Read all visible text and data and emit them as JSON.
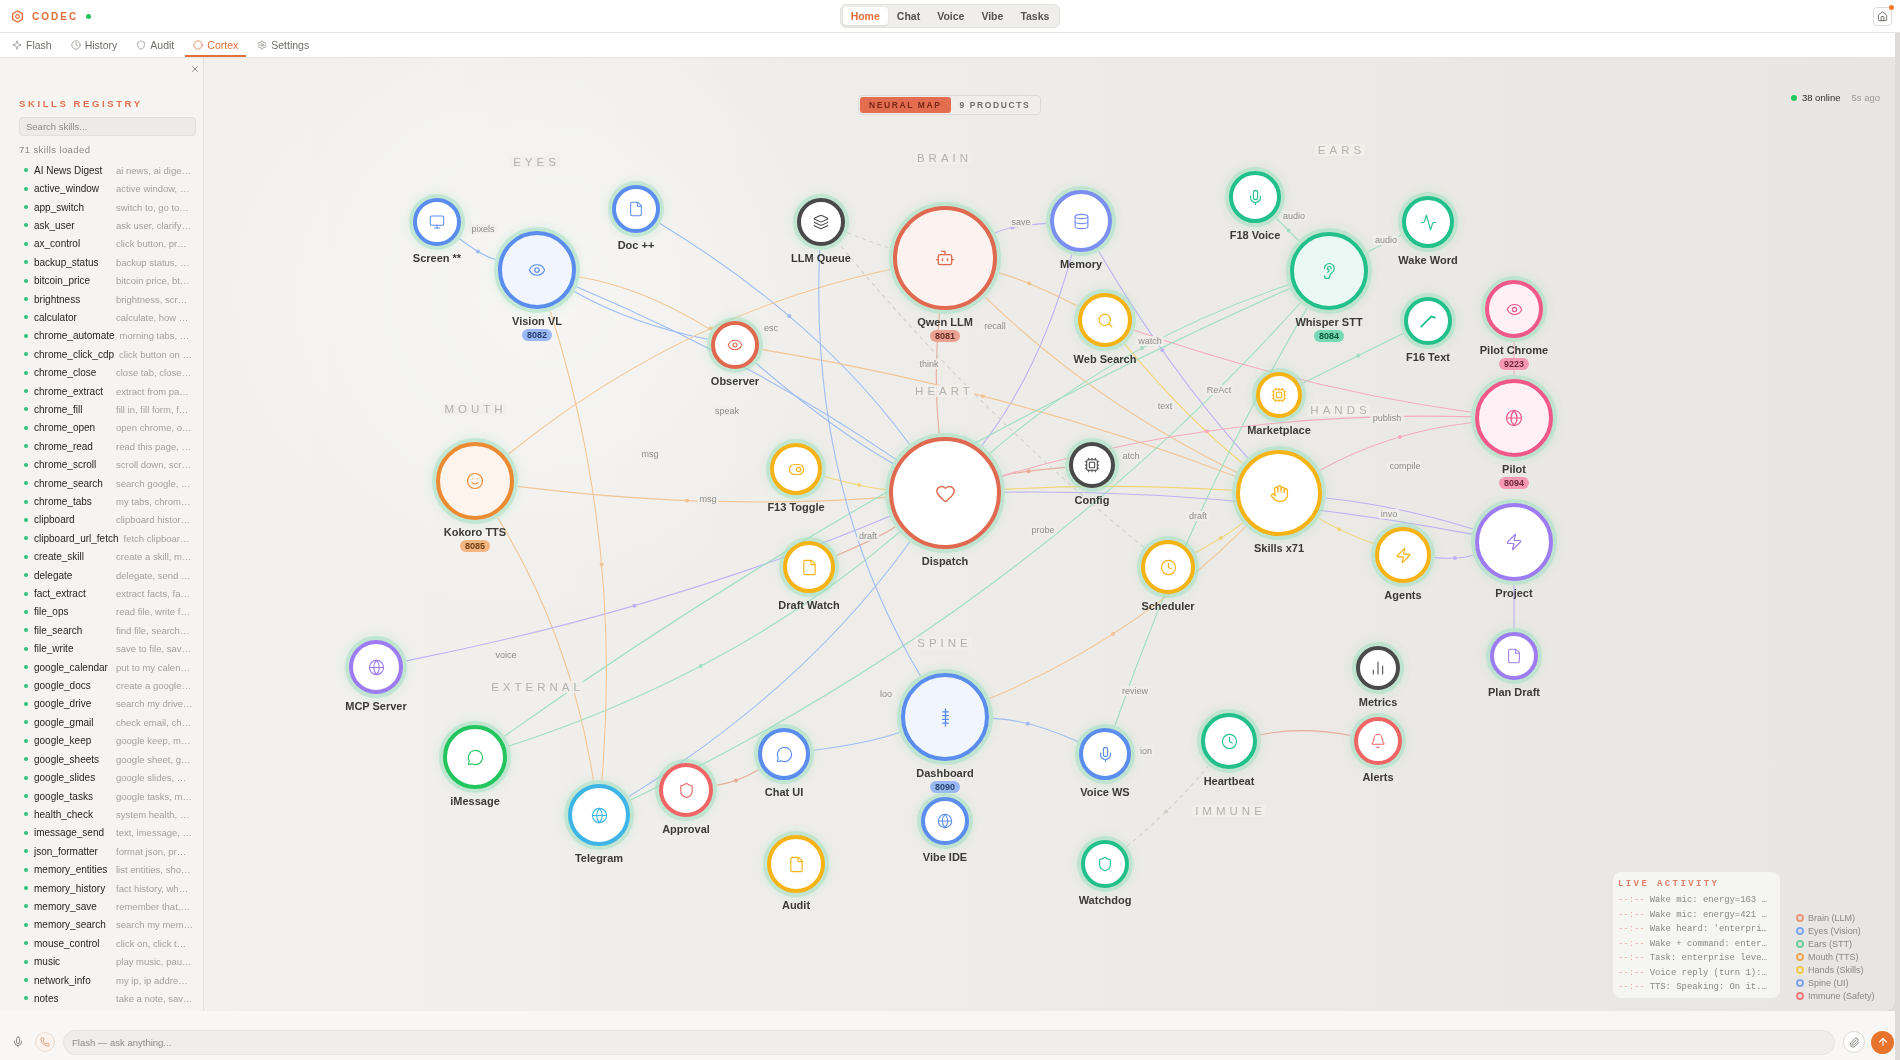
{
  "app": {
    "name": "CODEC",
    "connected": true
  },
  "nav": [
    {
      "label": "Home",
      "selected": true
    },
    {
      "label": "Chat",
      "selected": false
    },
    {
      "label": "Voice",
      "selected": false
    },
    {
      "label": "Vibe",
      "selected": false
    },
    {
      "label": "Tasks",
      "selected": false
    }
  ],
  "home_button": {
    "notification": true
  },
  "tabs": [
    {
      "label": "Flash",
      "selected": false
    },
    {
      "label": "History",
      "selected": false
    },
    {
      "label": "Audit",
      "selected": false
    },
    {
      "label": "Cortex",
      "selected": true
    },
    {
      "label": "Settings",
      "selected": false
    }
  ],
  "sidebar": {
    "title": "SKILLS REGISTRY",
    "search_placeholder": "Search skills...",
    "count": "71 skills loaded",
    "skills": [
      {
        "name": "AI News Digest",
        "description": "ai news, ai dige…"
      },
      {
        "name": "active_window",
        "description": "active window, …"
      },
      {
        "name": "app_switch",
        "description": "switch to, go to…"
      },
      {
        "name": "ask_user",
        "description": "ask user, clarify…"
      },
      {
        "name": "ax_control",
        "description": "click button, pr…"
      },
      {
        "name": "backup_status",
        "description": "backup status, …"
      },
      {
        "name": "bitcoin_price",
        "description": "bitcoin price, bt…"
      },
      {
        "name": "brightness",
        "description": "brightness, scr…"
      },
      {
        "name": "calculator",
        "description": "calculate, how …"
      },
      {
        "name": "chrome_automate",
        "description": "morning tabs, …"
      },
      {
        "name": "chrome_click_cdp",
        "description": "click button on …"
      },
      {
        "name": "chrome_close",
        "description": "close tab, close…"
      },
      {
        "name": "chrome_extract",
        "description": "extract from pa…"
      },
      {
        "name": "chrome_fill",
        "description": "fill in, fill form, f…"
      },
      {
        "name": "chrome_open",
        "description": "open chrome, o…"
      },
      {
        "name": "chrome_read",
        "description": "read this page, …"
      },
      {
        "name": "chrome_scroll",
        "description": "scroll down, scr…"
      },
      {
        "name": "chrome_search",
        "description": "search google, …"
      },
      {
        "name": "chrome_tabs",
        "description": "my tabs, chrom…"
      },
      {
        "name": "clipboard",
        "description": "clipboard histor…"
      },
      {
        "name": "clipboard_url_fetch",
        "description": "fetch clipboar…"
      },
      {
        "name": "create_skill",
        "description": "create a skill, m…"
      },
      {
        "name": "delegate",
        "description": "delegate, send …"
      },
      {
        "name": "fact_extract",
        "description": "extract facts, fa…"
      },
      {
        "name": "file_ops",
        "description": "read file, write f…"
      },
      {
        "name": "file_search",
        "description": "find file, search…"
      },
      {
        "name": "file_write",
        "description": "save to file, sav…"
      },
      {
        "name": "google_calendar",
        "description": "put to my calen…"
      },
      {
        "name": "google_docs",
        "description": "create a google…"
      },
      {
        "name": "google_drive",
        "description": "search my drive…"
      },
      {
        "name": "google_gmail",
        "description": "check email, ch…"
      },
      {
        "name": "google_keep",
        "description": "google keep, m…"
      },
      {
        "name": "google_sheets",
        "description": "google sheet, g…"
      },
      {
        "name": "google_slides",
        "description": "google slides, …"
      },
      {
        "name": "google_tasks",
        "description": "google tasks, m…"
      },
      {
        "name": "health_check",
        "description": "system health, …"
      },
      {
        "name": "imessage_send",
        "description": "text, imessage, …"
      },
      {
        "name": "json_formatter",
        "description": "format json, pr…"
      },
      {
        "name": "memory_entities",
        "description": "list entities, sho…"
      },
      {
        "name": "memory_history",
        "description": "fact history, wh…"
      },
      {
        "name": "memory_save",
        "description": "remember that,…"
      },
      {
        "name": "memory_search",
        "description": "search my mem…"
      },
      {
        "name": "mouse_control",
        "description": "click on, click t…"
      },
      {
        "name": "music",
        "description": "play music, pau…"
      },
      {
        "name": "network_info",
        "description": "my ip, ip addre…"
      },
      {
        "name": "notes",
        "description": "take a note, sav…"
      }
    ]
  },
  "map": {
    "views": [
      {
        "label": "NEURAL MAP",
        "selected": true
      },
      {
        "label": "9 PRODUCTS",
        "selected": false
      }
    ],
    "online": "38 online",
    "updated": "5s ago",
    "regions": [
      "EYES",
      "BRAIN",
      "EARS",
      "MOUTH",
      "HEART",
      "HANDS",
      "SPINE",
      "EXTERNAL",
      "IMMUNE"
    ],
    "edge_labels": [
      "pixels",
      "save",
      "audio",
      "audio",
      "recall",
      "think",
      "esc",
      "speak",
      "msg",
      "msg",
      "draft",
      "probe",
      "watch",
      "atch",
      "ReAct",
      "text",
      "publish",
      "compile",
      "draft",
      "invo",
      "voice",
      "review",
      "loo",
      "ion"
    ],
    "nodes": [
      {
        "label": "Screen **",
        "color": "#5b8def"
      },
      {
        "label": "Vision VL",
        "color": "#5b8def",
        "badge": "8082"
      },
      {
        "label": "Doc ++",
        "color": "#5b8def"
      },
      {
        "label": "LLM Queue",
        "color": "#4a4a4a"
      },
      {
        "label": "Qwen LLM",
        "color": "#e0694f",
        "badge": "8081"
      },
      {
        "label": "Memory",
        "color": "#7b8ff0"
      },
      {
        "label": "Observer",
        "color": "#e0694f"
      },
      {
        "label": "Web Search",
        "color": "#f5b316"
      },
      {
        "label": "F18 Voice",
        "color": "#22c08a"
      },
      {
        "label": "Whisper STT",
        "color": "#22c08a",
        "badge": "8084"
      },
      {
        "label": "Wake Word",
        "color": "#22c08a"
      },
      {
        "label": "F16 Text",
        "color": "#22c08a"
      },
      {
        "label": "Pilot Chrome",
        "color": "#f0588a",
        "badge": "9223"
      },
      {
        "label": "Pilot",
        "color": "#f0588a",
        "badge": "8094"
      },
      {
        "label": "Marketplace",
        "color": "#f5b316"
      },
      {
        "label": "Config",
        "color": "#4a4a4a"
      },
      {
        "label": "Skills x71",
        "color": "#f5b316"
      },
      {
        "label": "Agents",
        "color": "#f5b316"
      },
      {
        "label": "Project",
        "color": "#9d7cf2"
      },
      {
        "label": "Scheduler",
        "color": "#f5b316"
      },
      {
        "label": "Kokoro TTS",
        "color": "#ec8a32",
        "badge": "8085"
      },
      {
        "label": "F13 Toggle",
        "color": "#f5b316"
      },
      {
        "label": "Dispatch",
        "color": "#e0694f"
      },
      {
        "label": "Draft Watch",
        "color": "#f5b316"
      },
      {
        "label": "MCP Server",
        "color": "#9d7cf2"
      },
      {
        "label": "iMessage",
        "color": "#22c55e"
      },
      {
        "label": "Telegram",
        "color": "#3db5e6"
      },
      {
        "label": "Approval",
        "color": "#ef6464"
      },
      {
        "label": "Chat UI",
        "color": "#5b8def"
      },
      {
        "label": "Dashboard",
        "color": "#5b8def",
        "badge": "8090"
      },
      {
        "label": "Vibe IDE",
        "color": "#5b8def"
      },
      {
        "label": "Audit",
        "color": "#f5b316"
      },
      {
        "label": "Voice WS",
        "color": "#5b8def"
      },
      {
        "label": "Watchdog",
        "color": "#22c08a"
      },
      {
        "label": "Heartbeat",
        "color": "#22c08a"
      },
      {
        "label": "Metrics",
        "color": "#4a4a4a"
      },
      {
        "label": "Alerts",
        "color": "#ef6464"
      },
      {
        "label": "Plan Draft",
        "color": "#9d7cf2"
      }
    ]
  },
  "live_activity": {
    "title": "LIVE ACTIVITY",
    "entries": [
      {
        "time": "--:--",
        "text": "Wake mic: energy=163 …"
      },
      {
        "time": "--:--",
        "text": "Wake mic: energy=421 …"
      },
      {
        "time": "--:--",
        "text": "Wake heard: 'enterpri…"
      },
      {
        "time": "--:--",
        "text": "Wake + command: enter…"
      },
      {
        "time": "--:--",
        "text": "Task: enterprise leve…"
      },
      {
        "time": "--:--",
        "text": "Voice reply (turn 1):…"
      },
      {
        "time": "--:--",
        "text": "TTS: Speaking: On it.…"
      }
    ]
  },
  "legend": [
    {
      "label": "Brain (LLM)",
      "color": "#e8957a"
    },
    {
      "label": "Eyes (Vision)",
      "color": "#7ea6ee"
    },
    {
      "label": "Ears (STT)",
      "color": "#6fcfa0"
    },
    {
      "label": "Mouth (TTS)",
      "color": "#f0a65a"
    },
    {
      "label": "Hands (Skills)",
      "color": "#f2c84b"
    },
    {
      "label": "Spine (UI)",
      "color": "#7ea6ee"
    },
    {
      "label": "Immune (Safety)",
      "color": "#ef7c7c"
    }
  ],
  "composer": {
    "placeholder": "Flash — ask anything..."
  }
}
